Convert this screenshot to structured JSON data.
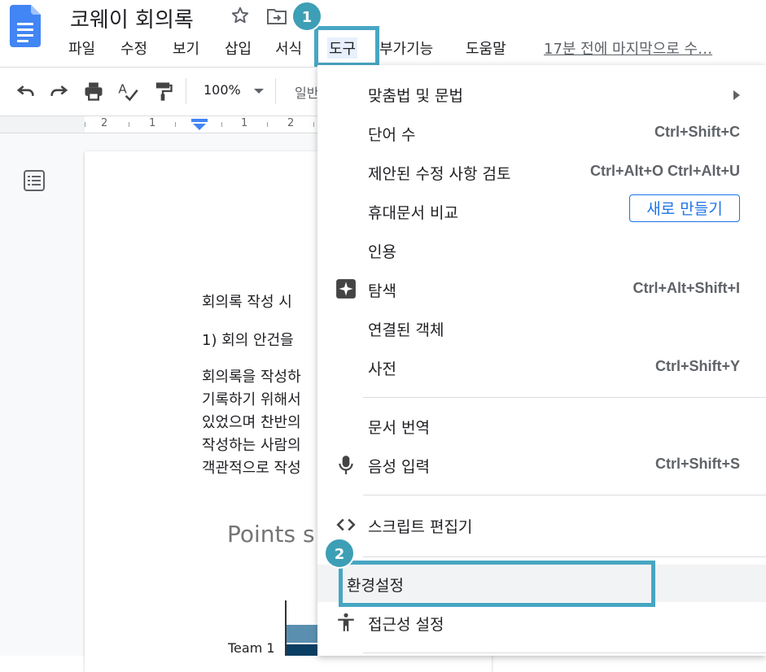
{
  "app": {
    "title": "코웨이 회의록",
    "last_edit": "17분 전에 마지막으로 수…"
  },
  "menu_bar": {
    "items": [
      "파일",
      "수정",
      "보기",
      "삽입",
      "서식",
      "도구",
      "부가기능",
      "도움말"
    ],
    "active": "도구"
  },
  "toolbar": {
    "zoom": "100%",
    "style": "일반"
  },
  "ruler": {
    "labels": [
      "2",
      "1",
      "1",
      "2"
    ]
  },
  "document": {
    "paragraphs": [
      "회의록 작성 시",
      "1) 회의 안건을",
      "회의록을 작성하",
      "기록하기 위해서",
      "있었으며 찬반의",
      "작성하는 사람의",
      "객관적으로 작성"
    ],
    "chart": {
      "title": "Points s",
      "category_label": "Team 1"
    }
  },
  "callouts": {
    "step1": "1",
    "step2": "2"
  },
  "tools_menu": {
    "items": [
      {
        "label": "맞춤법 및 문법",
        "shortcut": "",
        "submenu": true
      },
      {
        "label": "단어 수",
        "shortcut": "Ctrl+Shift+C"
      },
      {
        "label": "제안된 수정 사항 검토",
        "shortcut": "Ctrl+Alt+O Ctrl+Alt+U"
      },
      {
        "label": "휴대문서 비교",
        "button": "새로 만들기"
      },
      {
        "label": "인용",
        "shortcut": ""
      },
      {
        "label": "탐색",
        "shortcut": "Ctrl+Alt+Shift+I",
        "icon": "explore-icon"
      },
      {
        "label": "연결된 객체",
        "shortcut": ""
      },
      {
        "label": "사전",
        "shortcut": "Ctrl+Shift+Y"
      },
      {
        "label": "문서 번역",
        "shortcut": ""
      },
      {
        "label": "음성 입력",
        "shortcut": "Ctrl+Shift+S",
        "icon": "microphone-icon"
      },
      {
        "label": "스크립트 편집기",
        "shortcut": "",
        "icon": "code-icon"
      },
      {
        "label": "환경설정",
        "shortcut": "",
        "highlighted": true
      },
      {
        "label": "접근성 설정",
        "shortcut": "",
        "icon": "accessibility-icon"
      }
    ]
  },
  "colors": {
    "callout": "#48a6c3",
    "badge": "#3d9fb5",
    "link_blue": "#1a73e8",
    "docs_blue": "#4285f4"
  }
}
